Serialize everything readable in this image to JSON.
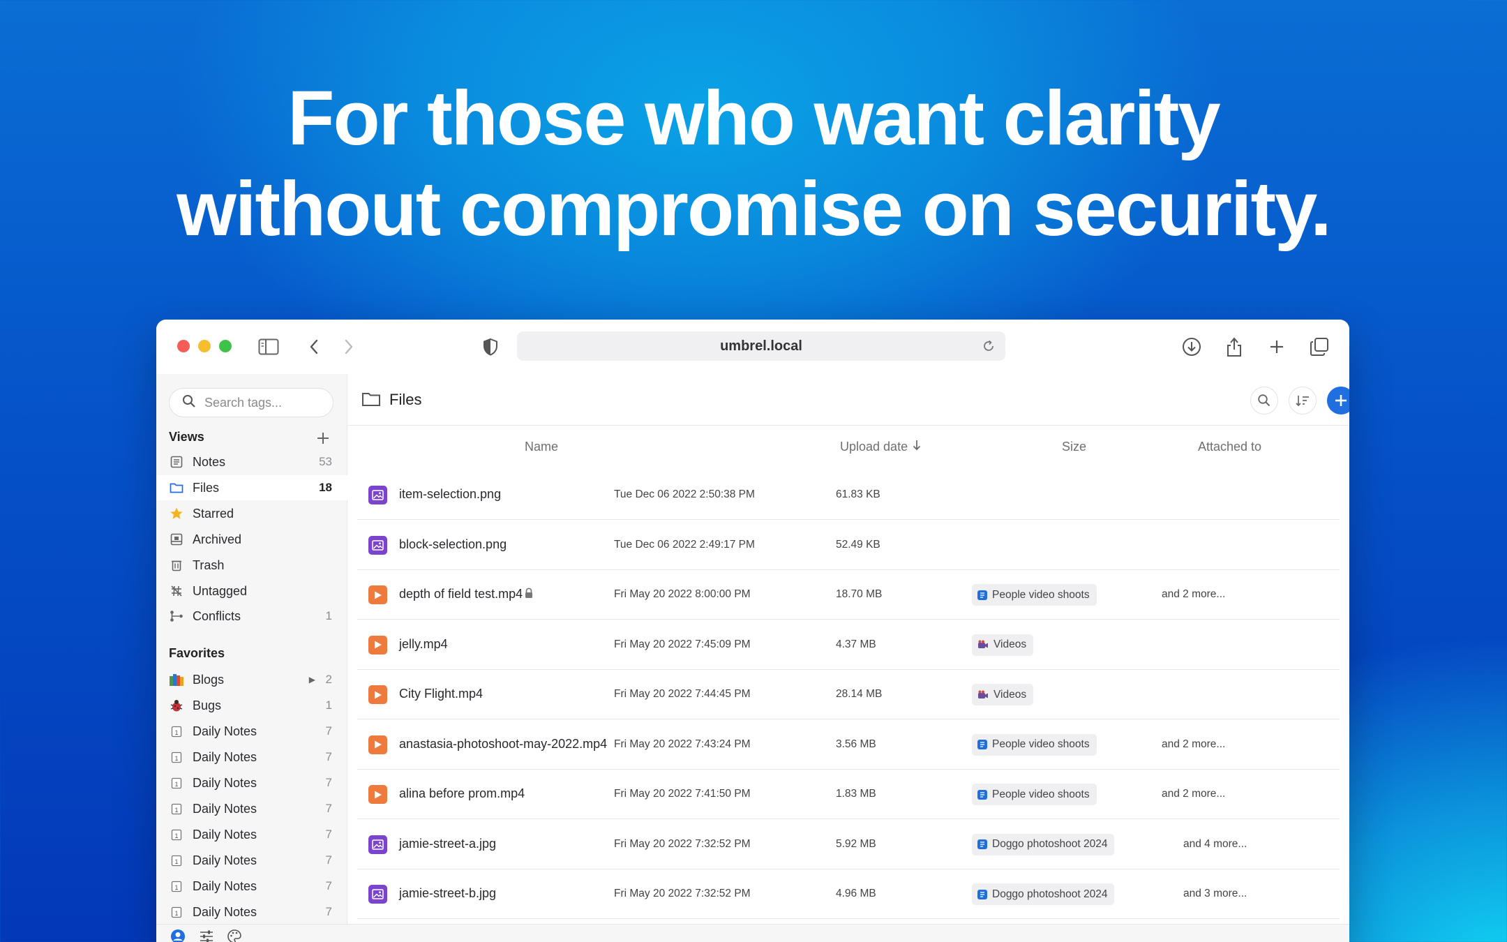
{
  "headline": {
    "line1": "For those who want clarity",
    "line2": "without compromise on security."
  },
  "browser": {
    "url": "umbrel.local"
  },
  "sidebar": {
    "search_placeholder": "Search tags...",
    "views_label": "Views",
    "views": [
      {
        "label": "Notes",
        "count": "53",
        "icon": "notes-icon"
      },
      {
        "label": "Files",
        "count": "18",
        "icon": "folder-icon",
        "active": true
      },
      {
        "label": "Starred",
        "count": "",
        "icon": "star-icon"
      },
      {
        "label": "Archived",
        "count": "",
        "icon": "archive-icon"
      },
      {
        "label": "Trash",
        "count": "",
        "icon": "trash-icon"
      },
      {
        "label": "Untagged",
        "count": "",
        "icon": "untagged-icon"
      },
      {
        "label": "Conflicts",
        "count": "1",
        "icon": "conflict-icon"
      }
    ],
    "favorites_label": "Favorites",
    "favorites": [
      {
        "label": "Blogs",
        "count": "2",
        "icon": "books-emoji-icon"
      },
      {
        "label": "Bugs",
        "count": "1",
        "icon": "bug-emoji-icon"
      },
      {
        "label": "Daily Notes",
        "count": "7",
        "icon": "calendar-icon"
      },
      {
        "label": "Daily Notes",
        "count": "7",
        "icon": "calendar-icon"
      },
      {
        "label": "Daily Notes",
        "count": "7",
        "icon": "calendar-icon"
      },
      {
        "label": "Daily Notes",
        "count": "7",
        "icon": "calendar-icon"
      },
      {
        "label": "Daily Notes",
        "count": "7",
        "icon": "calendar-icon"
      },
      {
        "label": "Daily Notes",
        "count": "7",
        "icon": "calendar-icon"
      },
      {
        "label": "Daily Notes",
        "count": "7",
        "icon": "calendar-icon"
      },
      {
        "label": "Daily Notes",
        "count": "7",
        "icon": "calendar-icon"
      }
    ]
  },
  "main": {
    "title": "Files",
    "columns": {
      "name": "Name",
      "upload_date": "Upload date",
      "size": "Size",
      "attached_to": "Attached to"
    },
    "files": [
      {
        "name": "item-selection.png",
        "type": "image",
        "date": "Tue Dec 06 2022 2:50:38 PM",
        "size": "61.83 KB",
        "tag": "",
        "more": ""
      },
      {
        "name": "block-selection.png",
        "type": "image",
        "date": "Tue Dec 06 2022 2:49:17 PM",
        "size": "52.49 KB",
        "tag": "",
        "more": ""
      },
      {
        "name": "depth of field test.mp4",
        "type": "video",
        "locked": true,
        "date": "Fri May 20 2022 8:00:00 PM",
        "size": "18.70 MB",
        "tag": "People video shoots",
        "tag_icon": "note",
        "more": "and 2 more..."
      },
      {
        "name": "jelly.mp4",
        "type": "video",
        "date": "Fri May 20 2022 7:45:09 PM",
        "size": "4.37 MB",
        "tag": "Videos",
        "tag_icon": "cam",
        "more": ""
      },
      {
        "name": "City Flight.mp4",
        "type": "video",
        "date": "Fri May 20 2022 7:44:45 PM",
        "size": "28.14 MB",
        "tag": "Videos",
        "tag_icon": "cam",
        "more": ""
      },
      {
        "name": "anastasia-photoshoot-may-2022.mp4",
        "type": "video",
        "date": "Fri May 20 2022 7:43:24 PM",
        "size": "3.56 MB",
        "tag": "People video shoots",
        "tag_icon": "note",
        "more": "and 2 more..."
      },
      {
        "name": "alina before prom.mp4",
        "type": "video",
        "date": "Fri May 20 2022 7:41:50 PM",
        "size": "1.83 MB",
        "tag": "People video shoots",
        "tag_icon": "note",
        "more": "and 2 more..."
      },
      {
        "name": "jamie-street-a.jpg",
        "type": "image",
        "date": "Fri May 20 2022 7:32:52 PM",
        "size": "5.92 MB",
        "tag": "Doggo photoshoot 2024",
        "tag_icon": "note",
        "more": "and 4 more..."
      },
      {
        "name": "jamie-street-b.jpg",
        "type": "image",
        "date": "Fri May 20 2022 7:32:52 PM",
        "size": "4.96 MB",
        "tag": "Doggo photoshoot 2024",
        "tag_icon": "note",
        "more": "and 3 more..."
      }
    ]
  },
  "colors": {
    "accent": "#1f6fe0",
    "image_file": "#7a44cc",
    "video_file": "#ee7a3e"
  }
}
